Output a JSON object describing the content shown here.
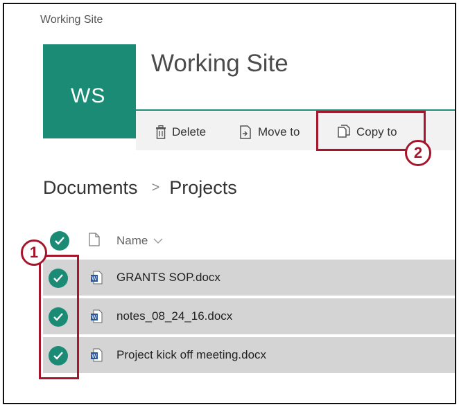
{
  "site": {
    "breadcrumb_top": "Working Site",
    "logo_initials": "WS",
    "title": "Working Site",
    "accent_color": "#1b8b76"
  },
  "commandbar": {
    "delete_label": "Delete",
    "delete_icon": "trash-icon",
    "move_label": "Move to",
    "move_icon": "move-to-icon",
    "copy_label": "Copy to",
    "copy_icon": "copy-icon"
  },
  "breadcrumb": {
    "items": [
      "Documents",
      "Projects"
    ],
    "separator": ">"
  },
  "list": {
    "header": {
      "name_label": "Name",
      "sort_icon": "chevron-down-icon"
    },
    "files": [
      {
        "name": "GRANTS SOP.docx",
        "selected": true,
        "icon": "word-doc-icon"
      },
      {
        "name": "notes_08_24_16.docx",
        "selected": true,
        "icon": "word-doc-icon"
      },
      {
        "name": "Project kick off meeting.docx",
        "selected": true,
        "icon": "word-doc-icon"
      }
    ]
  },
  "annotations": {
    "step1": "1",
    "step2": "2",
    "color": "#a5152b"
  }
}
